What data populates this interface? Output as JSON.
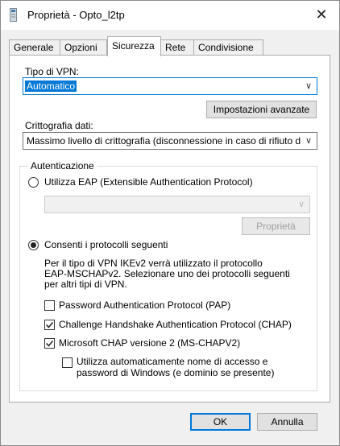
{
  "window": {
    "title": "Proprietà - Opto_l2tp"
  },
  "tabs": [
    {
      "label": "Generale"
    },
    {
      "label": "Opzioni"
    },
    {
      "label": "Sicurezza"
    },
    {
      "label": "Rete"
    },
    {
      "label": "Condivisione"
    }
  ],
  "vpn": {
    "type_label": "Tipo di VPN:",
    "type_value": "Automatico",
    "advanced_button": "Impostazioni avanzate",
    "encryption_label": "Crittografia dati:",
    "encryption_value": "Massimo livello di crittografia (disconnessione in caso di rifiuto d"
  },
  "auth": {
    "group_label": "Autenticazione",
    "use_eap_label": "Utilizza EAP (Extensible Authentication Protocol)",
    "eap_properties_button": "Proprietà",
    "allow_protocols_label": "Consenti i protocolli seguenti",
    "note_line1": "Per il tipo di VPN IKEv2 verrà utilizzato il protocollo",
    "note_line2": "EAP-MSCHAPv2. Selezionare uno dei protocolli seguenti",
    "note_line3": "per altri tipi di VPN.",
    "pap_label": "Password Authentication Protocol (PAP)",
    "chap_label": "Challenge Handshake Authentication Protocol (CHAP)",
    "mschap_label": "Microsoft CHAP versione 2 (MS-CHAPV2)",
    "auto_logon_line1": "Utilizza automaticamente nome di accesso e",
    "auto_logon_line2": "password di Windows (e dominio se presente)",
    "pap_checked": false,
    "chap_checked": true,
    "mschap_checked": true,
    "auto_logon_checked": false
  },
  "footer": {
    "ok": "OK",
    "cancel": "Annulla"
  },
  "icons": {
    "app": "document-icon",
    "close": "close-icon",
    "dropdown": "chevron-down-icon",
    "check": "checkmark-icon"
  },
  "colors": {
    "accent": "#0078d7"
  }
}
